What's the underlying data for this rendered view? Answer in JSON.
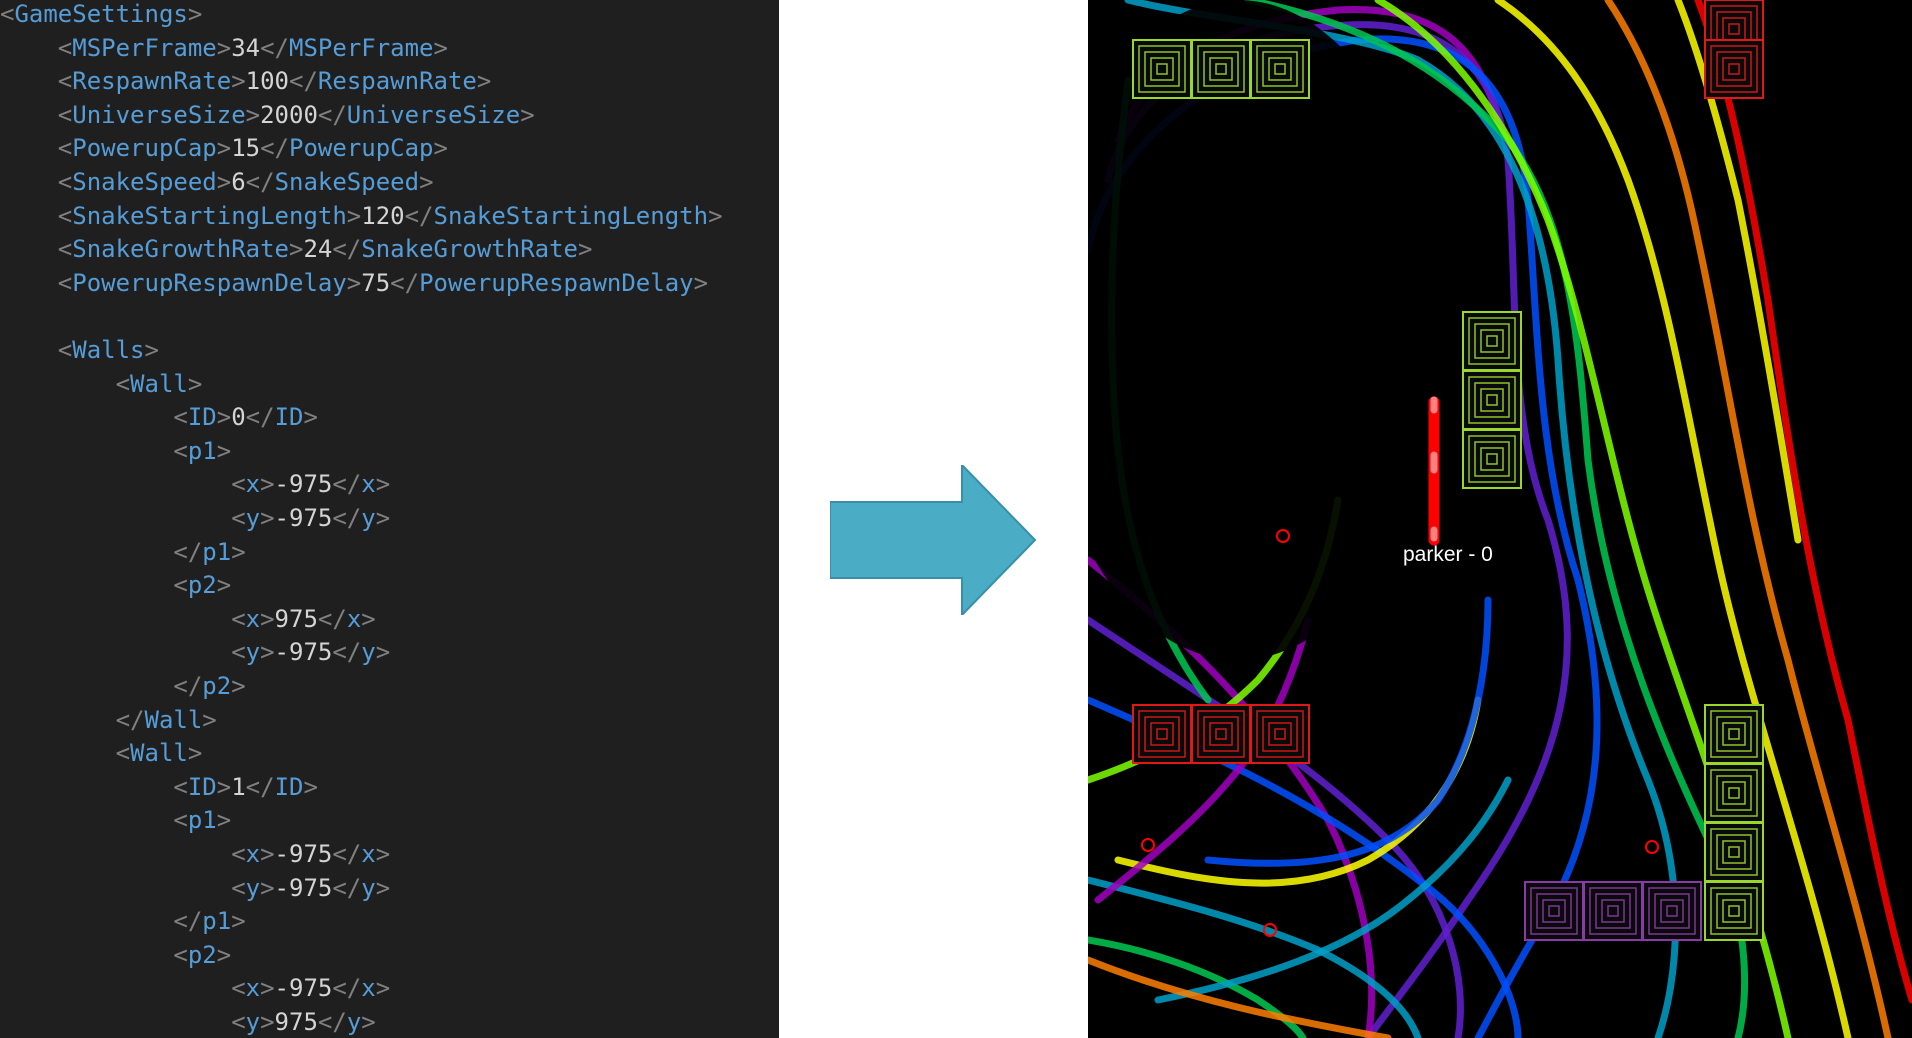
{
  "code_lines": [
    {
      "indent": 0,
      "kind": "open",
      "tag": "GameSettings"
    },
    {
      "indent": 1,
      "kind": "leaf",
      "tag": "MSPerFrame",
      "value": "34"
    },
    {
      "indent": 1,
      "kind": "leaf",
      "tag": "RespawnRate",
      "value": "100"
    },
    {
      "indent": 1,
      "kind": "leaf",
      "tag": "UniverseSize",
      "value": "2000"
    },
    {
      "indent": 1,
      "kind": "leaf",
      "tag": "PowerupCap",
      "value": "15"
    },
    {
      "indent": 1,
      "kind": "leaf",
      "tag": "SnakeSpeed",
      "value": "6"
    },
    {
      "indent": 1,
      "kind": "leaf",
      "tag": "SnakeStartingLength",
      "value": "120"
    },
    {
      "indent": 1,
      "kind": "leaf",
      "tag": "SnakeGrowthRate",
      "value": "24"
    },
    {
      "indent": 1,
      "kind": "leaf",
      "tag": "PowerupRespawnDelay",
      "value": "75"
    },
    {
      "indent": 0,
      "kind": "blank"
    },
    {
      "indent": 1,
      "kind": "open",
      "tag": "Walls"
    },
    {
      "indent": 2,
      "kind": "open",
      "tag": "Wall"
    },
    {
      "indent": 3,
      "kind": "leaf",
      "tag": "ID",
      "value": "0"
    },
    {
      "indent": 3,
      "kind": "open",
      "tag": "p1"
    },
    {
      "indent": 4,
      "kind": "leaf",
      "tag": "x",
      "value": "-975"
    },
    {
      "indent": 4,
      "kind": "leaf",
      "tag": "y",
      "value": "-975"
    },
    {
      "indent": 3,
      "kind": "close",
      "tag": "p1"
    },
    {
      "indent": 3,
      "kind": "open",
      "tag": "p2"
    },
    {
      "indent": 4,
      "kind": "leaf",
      "tag": "x",
      "value": "975"
    },
    {
      "indent": 4,
      "kind": "leaf",
      "tag": "y",
      "value": "-975"
    },
    {
      "indent": 3,
      "kind": "close",
      "tag": "p2"
    },
    {
      "indent": 2,
      "kind": "close",
      "tag": "Wall"
    },
    {
      "indent": 2,
      "kind": "open",
      "tag": "Wall"
    },
    {
      "indent": 3,
      "kind": "leaf",
      "tag": "ID",
      "value": "1"
    },
    {
      "indent": 3,
      "kind": "open",
      "tag": "p1"
    },
    {
      "indent": 4,
      "kind": "leaf",
      "tag": "x",
      "value": "-975"
    },
    {
      "indent": 4,
      "kind": "leaf",
      "tag": "y",
      "value": "-975"
    },
    {
      "indent": 3,
      "kind": "close",
      "tag": "p1"
    },
    {
      "indent": 3,
      "kind": "open",
      "tag": "p2"
    },
    {
      "indent": 4,
      "kind": "leaf",
      "tag": "x",
      "value": "-975"
    },
    {
      "indent": 4,
      "kind": "leaf",
      "tag": "y",
      "value": "975"
    }
  ],
  "arrow": {
    "color": "#4bacc6",
    "icon": "right-arrow-icon"
  },
  "game": {
    "background": "#000000",
    "player_label": "parker - 0",
    "snake_color": "#ff0000",
    "snake_highlight": "#ff8080",
    "powerup_color": "#ff0000",
    "wall_colors": {
      "green": "#9bd62a",
      "red": "#e01818",
      "purple": "#8a3aa8"
    },
    "trail_colors": [
      "#ff0000",
      "#ff7f00",
      "#ffff00",
      "#7fff00",
      "#00c850",
      "#00a0c8",
      "#0050ff",
      "#6020d0",
      "#a000c0"
    ]
  }
}
